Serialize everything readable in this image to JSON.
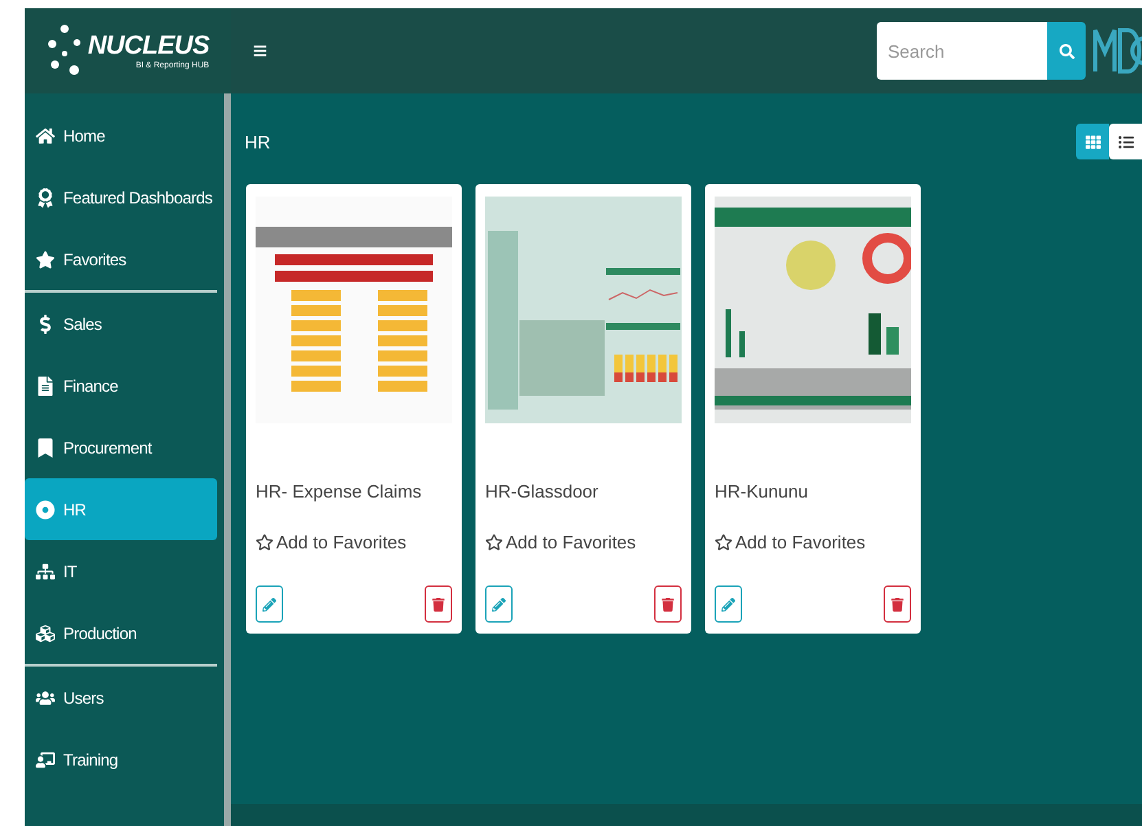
{
  "brand": {
    "name": "NUCLEUS",
    "tagline": "BI & Reporting HUB"
  },
  "topbar": {
    "menu_glyph": "≡",
    "search": {
      "placeholder": "Search"
    }
  },
  "sidebar": {
    "groups": [
      [
        {
          "label": "Home",
          "selected": false
        },
        {
          "label": "Featured Dashboards",
          "selected": false
        },
        {
          "label": "Favorites",
          "selected": false
        }
      ],
      [
        {
          "label": "Sales",
          "selected": false
        },
        {
          "label": "Finance",
          "selected": false
        },
        {
          "label": "Procurement",
          "selected": false
        },
        {
          "label": "HR",
          "selected": true
        },
        {
          "label": "IT",
          "selected": false
        },
        {
          "label": "Production",
          "selected": false
        }
      ],
      [
        {
          "label": "Users",
          "selected": false
        },
        {
          "label": "Training",
          "selected": false
        }
      ]
    ]
  },
  "page": {
    "title": "HR",
    "views": [
      {
        "kind": "grid",
        "selected": true
      },
      {
        "kind": "list",
        "selected": false
      }
    ]
  },
  "cards": [
    {
      "title": "HR- Expense Claims",
      "favorite_label": "Add to Favorites"
    },
    {
      "title": "HR-Glassdoor",
      "favorite_label": "Add to Favorites"
    },
    {
      "title": "HR-Kununu",
      "favorite_label": "Add to Favorites"
    }
  ]
}
